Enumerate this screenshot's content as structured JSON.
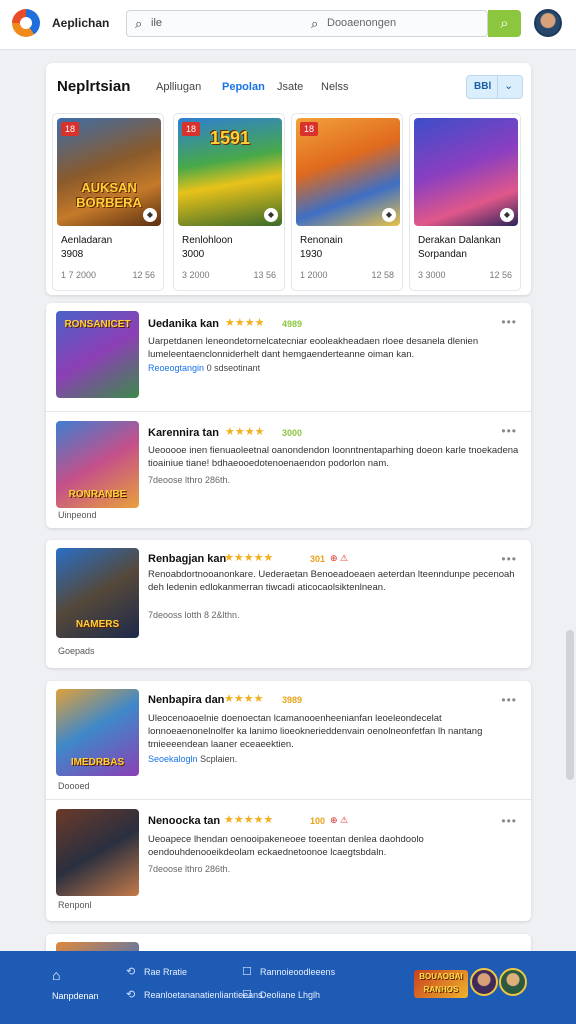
{
  "header": {
    "app_title": "Aeplichan",
    "search_query": "ile",
    "search_placeholder": "Dooaenongen"
  },
  "featured": {
    "title": "Neplrtsian",
    "tabs": [
      "Aplliugan",
      "Pepolan",
      "Jsate",
      "Nelss"
    ],
    "active_tab": 1,
    "dropdown_label": "BBl",
    "games": [
      {
        "name": "Aenladaran",
        "sub": "3908",
        "meta_left": "1 7 2000",
        "meta_right": "12 56",
        "overlay": "AUKSAN BORBERA",
        "badge": "18"
      },
      {
        "name": "Renlohloon",
        "sub": "3000",
        "meta_left": "3 2000",
        "meta_right": "13 56",
        "overlay": "1591",
        "badge": "18"
      },
      {
        "name": "Renonain",
        "sub": "1930",
        "meta_left": "1 2000",
        "meta_right": "12 58",
        "overlay": "",
        "badge": "18"
      },
      {
        "name": "Derakan Dalankan",
        "sub": "Sorpandan",
        "meta_left": "3 3000",
        "meta_right": "12 56",
        "overlay": "",
        "badge": ""
      }
    ]
  },
  "list": [
    {
      "title": "Uedanika kan",
      "stars": "★★★★",
      "rating": "4989",
      "desc": "Uarpetdanen leneondetornelcatecniar eooleakheadaen rloee desanela dlenien lumeleentaenclonniderhelt dant hemgaenderteanne oiman kan.",
      "link": "Reoeogtangin",
      "link_rest": "0 sdseotinant",
      "meta": "",
      "foot": "",
      "thumb_label": "RONSANICET"
    },
    {
      "title": "Karennira tan",
      "stars": "★★★★",
      "rating": "3000",
      "desc": "Ueooooe inen fienuaoleetnal oanondendon loonntnentaparhing doeon karle tnoekadena tioainiue tiane! bdhaeooedotenoenaendon podorlon nam.",
      "link": "",
      "link_rest": "",
      "meta": "7deoose lthro 286th.",
      "foot": "Uinpeond",
      "thumb_label": "RONRANBE"
    },
    {
      "title": "Renbagjan kan",
      "stars": "★★★★★",
      "rating": "301",
      "extra": "⊕ ⚠",
      "desc": "Renoabdortnooanonkare. Uederaetan Benoeadoeaen aeterdan lteenndunpe pecenoah deh ledenin edlokanmerran tiwcadi aticocaolsiktenlnean.",
      "link": "",
      "link_rest": "",
      "meta": "7deooss lotth 8 2&lthn.",
      "foot": "Goepads",
      "thumb_label": "NAMERS"
    },
    {
      "title": "Nenbapira dan",
      "stars": "★★★★",
      "rating": "3989",
      "desc": "Uleocenoaoelnie doenoectan lcamanooenheenianfan leoeleondecelat lonnoeaenonelnolfer ka lanimo lioeoknerieddenvain oenolneonfetfan lh nantang tmieeeendean laaner eceaeektien.",
      "link": "Seoekalogln",
      "link_rest": "Scplaien.",
      "meta": "",
      "foot": "Doooed",
      "thumb_label": "IMEDRBAS"
    },
    {
      "title": "Nenoocka tan",
      "stars": "★★★★★",
      "rating": "100",
      "extra": "⊕ ⚠",
      "desc": "Ueoapece lhendan oenooipakeneoee toeentan denlea daohdoolo oendouhdenooeikdeolam eckaednetoonoe lcaegtsbdaln.",
      "link": "",
      "link_rest": "",
      "meta": "7deoose lthro 286th.",
      "foot": "Renponl",
      "thumb_label": ""
    }
  ],
  "bottom": {
    "home_label": "Nanpdenan",
    "links": [
      "Rae Rratie",
      "Reanloetananatienliantieeans",
      "Rannoieoodleeens",
      "Deoliane Lhglh"
    ],
    "logo_text": "BOUAOBAI RANHOS"
  },
  "colors": {
    "accent_blue": "#1a73e8",
    "search_green": "#8cc63f",
    "star_gold": "#f2b01e",
    "bottom_bar": "#1e5bb5"
  }
}
